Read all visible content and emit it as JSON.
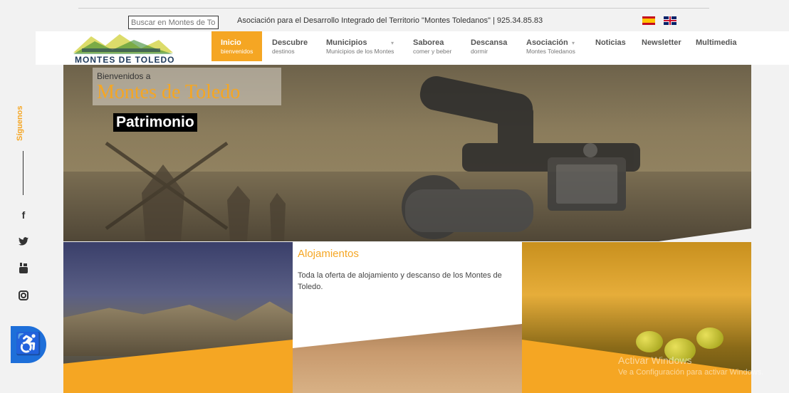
{
  "search": {
    "placeholder": "Buscar en Montes de Toledo"
  },
  "header": {
    "info": "Asociación para el Desarrollo Integrado del Territorio \"Montes Toledanos\" | 925.34.85.83"
  },
  "logo": {
    "text": "MONTES DE TOLEDO"
  },
  "nav": [
    {
      "title": "Inicio",
      "sub": "bienvenidos"
    },
    {
      "title": "Descubre",
      "sub": "destinos"
    },
    {
      "title": "Municipios",
      "sub": "Municipios de los Montes"
    },
    {
      "title": "Saborea",
      "sub": "comer y beber"
    },
    {
      "title": "Descansa",
      "sub": "dormir"
    },
    {
      "title": "Asociación",
      "sub": "Montes Toledanos"
    },
    {
      "title": "Noticias",
      "sub": ""
    },
    {
      "title": "Newsletter",
      "sub": ""
    },
    {
      "title": "Multimedia",
      "sub": ""
    }
  ],
  "hero": {
    "welcome": "Bienvenidos a",
    "title": "Montes de Toledo",
    "tag": "Patrimonio"
  },
  "sidebar": {
    "label": "Síguenos"
  },
  "cards": {
    "alojamientos_title": "Alojamientos",
    "alojamientos_desc": "Toda la oferta de alojamiento y descanso de los Montes de Toledo."
  },
  "watermark": {
    "line1": "Activar Windows",
    "line2": "Ve a Configuración para activar Windows."
  },
  "colors": {
    "accent": "#f5a623",
    "logo": "#1f3b5c",
    "accessibility": "#1e6fd9"
  }
}
